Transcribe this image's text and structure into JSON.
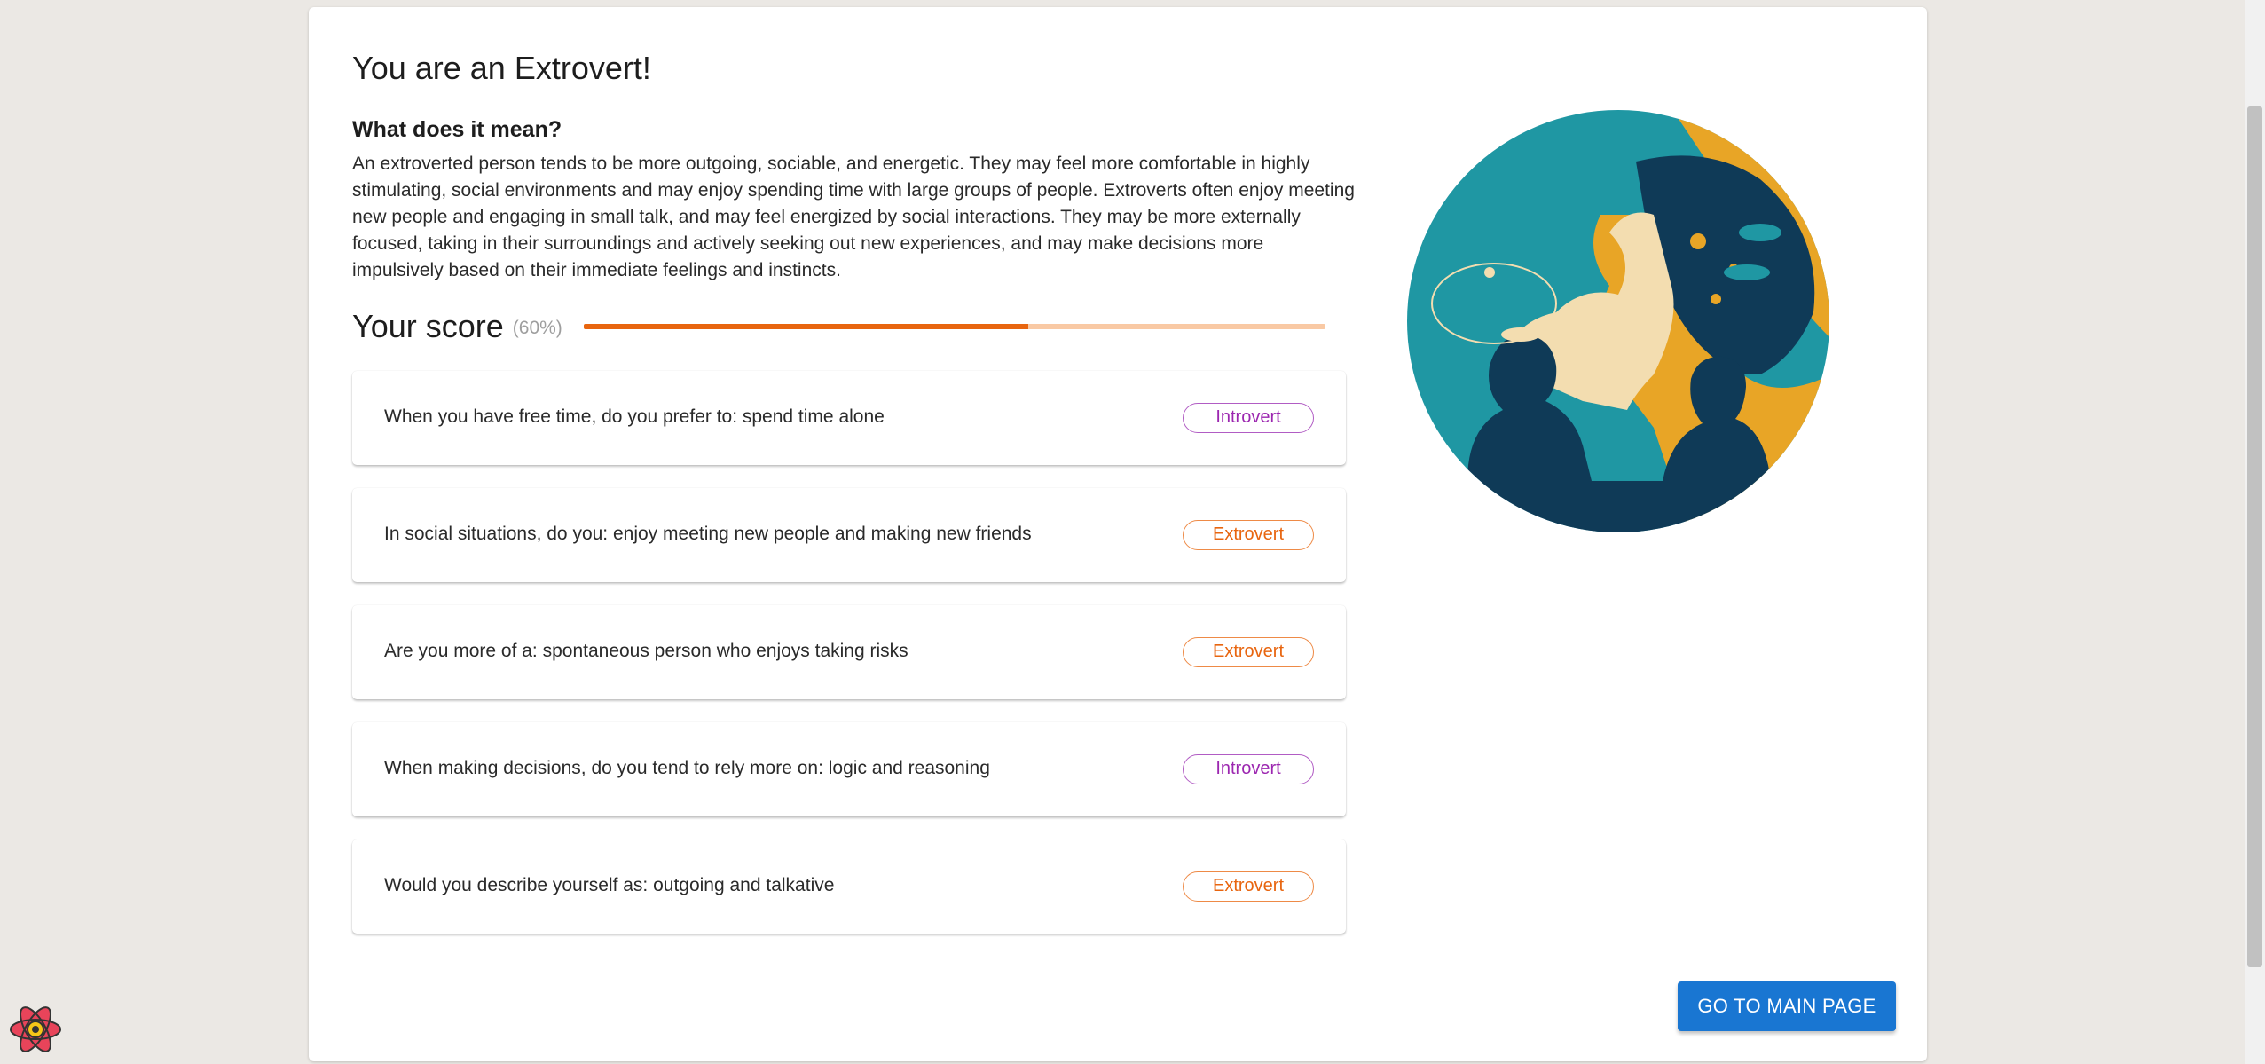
{
  "result": {
    "title": "You are an Extrovert!",
    "subtitle": "What does it mean?",
    "description": "An extroverted person tends to be more outgoing, sociable, and energetic. They may feel more comfortable in highly stimulating, social environments and may enjoy spending time with large groups of people. Extroverts often enjoy meeting new people and engaging in small talk, and may feel energized by social interactions. They may be more externally focused, taking in their surroundings and actively seeking out new experiences, and may make decisions more impulsively based on their immediate feelings and instincts."
  },
  "score": {
    "label": "Your score",
    "percent_text": "(60%)",
    "value": 0.6
  },
  "answers": [
    {
      "text": "When you have free time, do you prefer to: spend time alone",
      "tag": "Introvert",
      "type": "introvert"
    },
    {
      "text": "In social situations, do you: enjoy meeting new people and making new friends",
      "tag": "Extrovert",
      "type": "extrovert"
    },
    {
      "text": "Are you more of a: spontaneous person who enjoys taking risks",
      "tag": "Extrovert",
      "type": "extrovert"
    },
    {
      "text": "When making decisions, do you tend to rely more on: logic and reasoning",
      "tag": "Introvert",
      "type": "introvert"
    },
    {
      "text": "Would you describe yourself as: outgoing and talkative",
      "tag": "Extrovert",
      "type": "extrovert"
    }
  ],
  "actions": {
    "main_page_label": "GO TO MAIN PAGE"
  },
  "colors": {
    "primary": "#1976d2",
    "extrovert": "#e8650f",
    "introvert": "#9c27b0",
    "progress_track": "#f9c9a4"
  },
  "icons": {
    "illustration": "two-people-conversation-illustration",
    "devtools": "react-devtools-icon"
  }
}
